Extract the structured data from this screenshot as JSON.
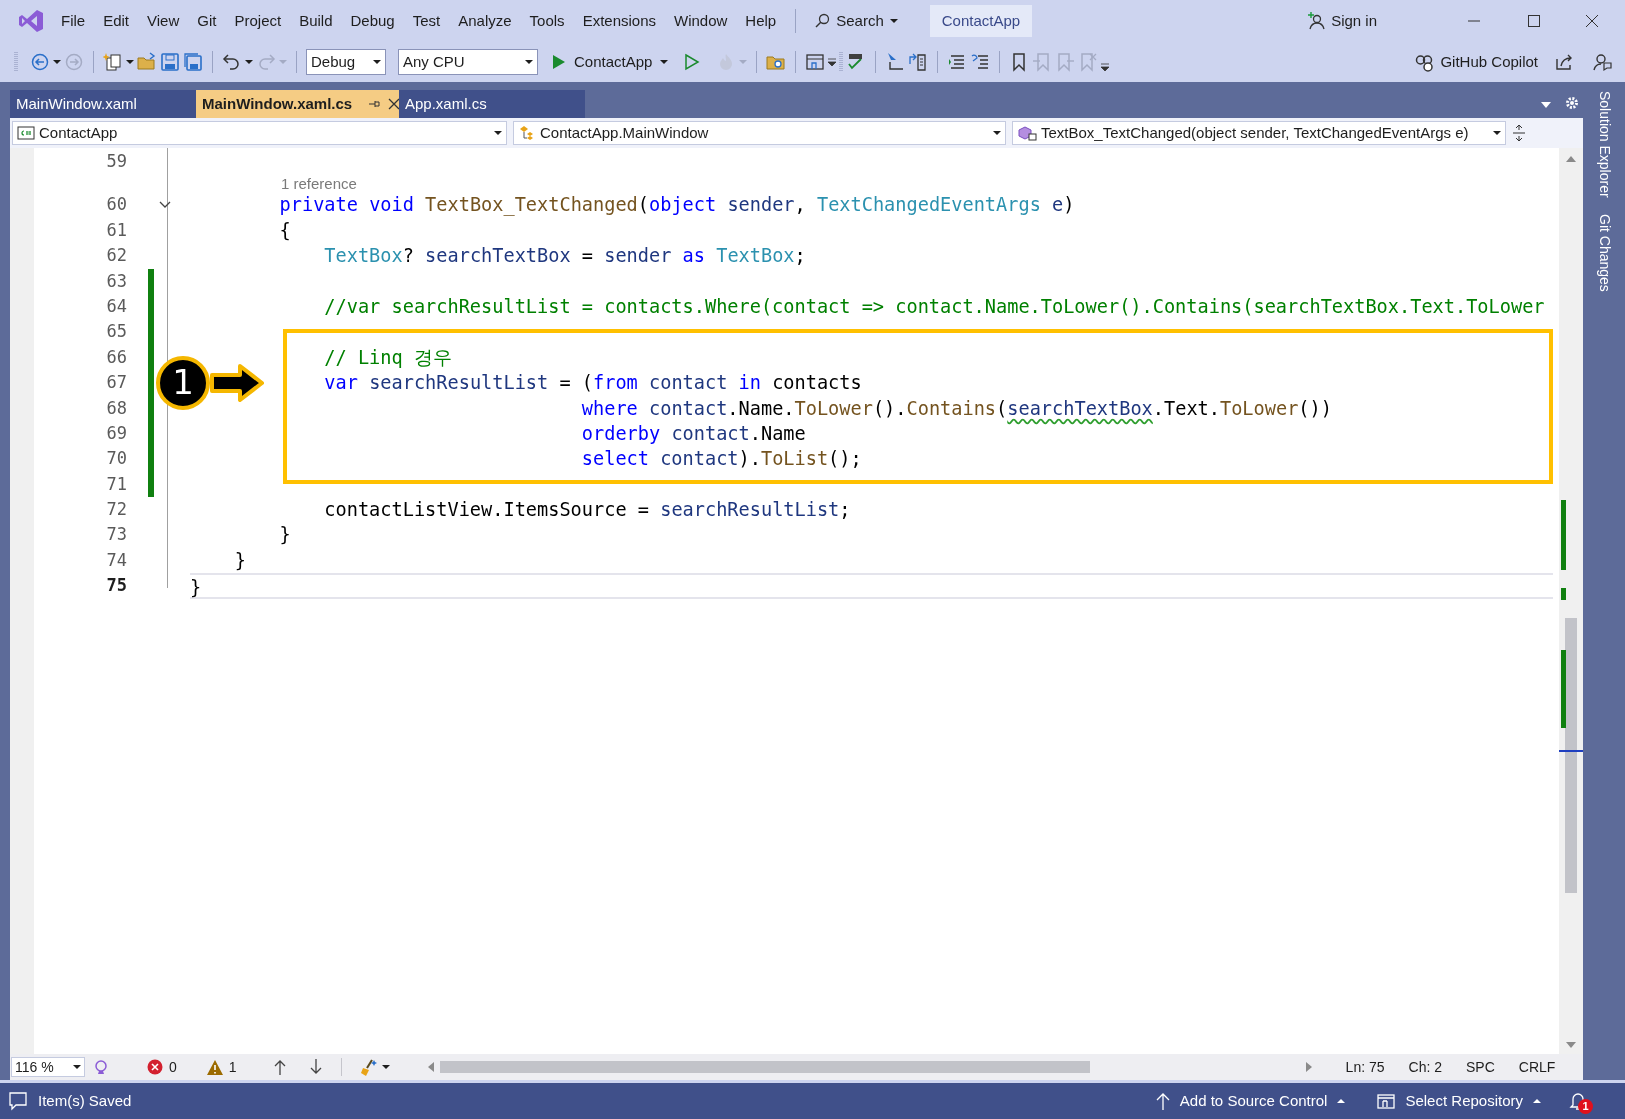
{
  "menu": [
    "File",
    "Edit",
    "View",
    "Git",
    "Project",
    "Build",
    "Debug",
    "Test",
    "Analyze",
    "Tools",
    "Extensions",
    "Window",
    "Help"
  ],
  "search": "Search",
  "solution_name": "ContactApp",
  "sign_in": "Sign in",
  "toolbar": {
    "configuration": "Debug",
    "platform": "Any CPU",
    "start_target": "ContactApp",
    "copilot": "GitHub Copilot"
  },
  "tabs": [
    {
      "label": "MainWindow.xaml",
      "selected": false
    },
    {
      "label": "MainWindow.xaml.cs",
      "selected": true
    },
    {
      "label": "App.xaml.cs",
      "selected": false
    }
  ],
  "nav_bar": {
    "project": "ContactApp",
    "type": "ContactApp.MainWindow",
    "member": "TextBox_TextChanged(object sender, TextChangedEventArgs e)"
  },
  "side_panel": [
    "Solution Explorer",
    "Git Changes"
  ],
  "editor": {
    "lines": [
      {
        "number": "59",
        "changed": false,
        "highlighted": false,
        "current": false
      },
      {
        "number": "60",
        "changed": false,
        "highlighted": false,
        "current": false,
        "codelens": "1 reference",
        "expanded": true,
        "tokens": [
          {
            "text": "        private",
            "kind": "kw"
          },
          {
            "text": " void",
            "kind": "kw"
          },
          {
            "text": " TextBox_TextChanged",
            "kind": "method"
          },
          {
            "text": "(",
            "kind": "plain"
          },
          {
            "text": "object",
            "kind": "kw"
          },
          {
            "text": " sender",
            "kind": "param"
          },
          {
            "text": ", ",
            "kind": "plain"
          },
          {
            "text": "TextChangedEventArgs",
            "kind": "type"
          },
          {
            "text": " e",
            "kind": "param"
          },
          {
            "text": ")",
            "kind": "plain"
          }
        ]
      },
      {
        "number": "61",
        "changed": false,
        "highlighted": false,
        "current": false,
        "tokens": [
          {
            "text": "        {",
            "kind": "plain"
          }
        ]
      },
      {
        "number": "62",
        "changed": false,
        "highlighted": false,
        "current": false,
        "tokens": [
          {
            "text": "            TextBox",
            "kind": "type"
          },
          {
            "text": "? ",
            "kind": "plain"
          },
          {
            "text": "searchTextBox",
            "kind": "local"
          },
          {
            "text": " = ",
            "kind": "plain"
          },
          {
            "text": "sender",
            "kind": "param"
          },
          {
            "text": " as ",
            "kind": "kw"
          },
          {
            "text": "TextBox",
            "kind": "type"
          },
          {
            "text": ";",
            "kind": "plain"
          }
        ]
      },
      {
        "number": "63",
        "changed": true,
        "highlighted": false,
        "current": false
      },
      {
        "number": "64",
        "changed": true,
        "highlighted": false,
        "current": false,
        "tokens": [
          {
            "text": "            //var searchResultList = contacts.Where(contact => contact.Name.ToLower().Contains(searchTextBox.Text.ToLower",
            "kind": "comment"
          }
        ]
      },
      {
        "number": "65",
        "changed": true,
        "highlighted": false,
        "current": false
      },
      {
        "number": "66",
        "changed": true,
        "highlighted": true,
        "current": false,
        "tokens": [
          {
            "text": "            // Linq 경우",
            "kind": "comment"
          }
        ]
      },
      {
        "number": "67",
        "changed": true,
        "highlighted": true,
        "current": false,
        "callout": "1",
        "tokens": [
          {
            "text": "            var",
            "kind": "kw"
          },
          {
            "text": " searchResultList",
            "kind": "local"
          },
          {
            "text": " = (",
            "kind": "plain"
          },
          {
            "text": "from",
            "kind": "kw"
          },
          {
            "text": " contact ",
            "kind": "local"
          },
          {
            "text": "in",
            "kind": "kw"
          },
          {
            "text": " contacts",
            "kind": "plain"
          }
        ]
      },
      {
        "number": "68",
        "changed": true,
        "highlighted": true,
        "current": false,
        "tokens": [
          {
            "text": "                                   where",
            "kind": "kw"
          },
          {
            "text": " contact",
            "kind": "local"
          },
          {
            "text": ".Name.",
            "kind": "plain"
          },
          {
            "text": "ToLower",
            "kind": "method"
          },
          {
            "text": "().",
            "kind": "plain"
          },
          {
            "text": "Contains",
            "kind": "method"
          },
          {
            "text": "(",
            "kind": "plain"
          },
          {
            "text": "searchTextBox",
            "kind": "local",
            "squiggle": true
          },
          {
            "text": ".Text.",
            "kind": "plain"
          },
          {
            "text": "ToLower",
            "kind": "method"
          },
          {
            "text": "())",
            "kind": "plain"
          }
        ]
      },
      {
        "number": "69",
        "changed": true,
        "highlighted": true,
        "current": false,
        "tokens": [
          {
            "text": "                                   orderby",
            "kind": "kw"
          },
          {
            "text": " contact",
            "kind": "local"
          },
          {
            "text": ".Name",
            "kind": "plain"
          }
        ]
      },
      {
        "number": "70",
        "changed": true,
        "highlighted": true,
        "current": false,
        "tokens": [
          {
            "text": "                                   select",
            "kind": "kw"
          },
          {
            "text": " contact",
            "kind": "local"
          },
          {
            "text": ").",
            "kind": "plain"
          },
          {
            "text": "ToList",
            "kind": "method"
          },
          {
            "text": "();",
            "kind": "plain"
          }
        ]
      },
      {
        "number": "71",
        "changed": true,
        "highlighted": false,
        "current": false
      },
      {
        "number": "72",
        "changed": false,
        "highlighted": false,
        "current": false,
        "tokens": [
          {
            "text": "            contactListView.ItemsSource = ",
            "kind": "plain"
          },
          {
            "text": "searchResultList",
            "kind": "local"
          },
          {
            "text": ";",
            "kind": "plain"
          }
        ]
      },
      {
        "number": "73",
        "changed": false,
        "highlighted": false,
        "current": false,
        "tokens": [
          {
            "text": "        }",
            "kind": "plain"
          }
        ]
      },
      {
        "number": "74",
        "changed": false,
        "highlighted": false,
        "current": false,
        "tokens": [
          {
            "text": "    }",
            "kind": "plain"
          }
        ]
      },
      {
        "number": "75",
        "changed": false,
        "highlighted": false,
        "current": true,
        "tokens": [
          {
            "text": "}",
            "kind": "plain"
          }
        ]
      }
    ]
  },
  "editor_status": {
    "zoom": "116 %",
    "errors": "0",
    "warnings": "1",
    "line": "Ln: 75",
    "column": "Ch: 2",
    "indent": "SPC",
    "line_ending": "CRLF"
  },
  "status_bar": {
    "message": "Item(s) Saved",
    "source_control": "Add to Source Control",
    "repository": "Select Repository",
    "notifications": "1"
  }
}
